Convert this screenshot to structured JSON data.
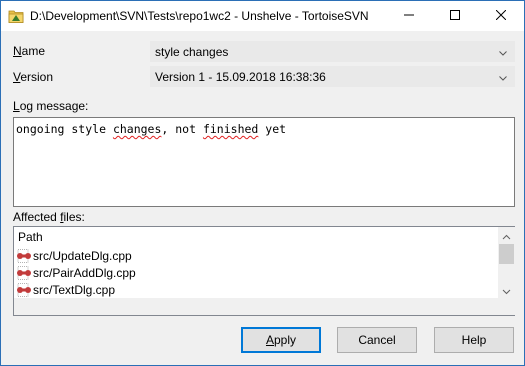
{
  "window": {
    "title": "D:\\Development\\SVN\\Tests\\repo1wc2 - Unshelve - TortoiseSVN",
    "minimize_icon": "minimize-icon",
    "maximize_icon": "maximize-icon",
    "close_icon": "close-icon"
  },
  "form": {
    "name_label_prefix": "",
    "name_label_accel": "N",
    "name_label_rest": "ame",
    "name_value": "style changes",
    "version_label_accel": "V",
    "version_label_rest": "ersion",
    "version_value": "Version 1 - 15.09.2018 16:38:36",
    "log_label_prefix": "",
    "log_label_accel": "L",
    "log_label_rest": "og message:",
    "log_text_1": "ongoing style ",
    "log_text_spell": "changes",
    "log_text_2": ", not ",
    "log_text_spell2": "finished",
    "log_text_3": " yet",
    "affected_label_prefix": "Affected ",
    "affected_label_accel": "f",
    "affected_label_rest": "iles:"
  },
  "files": {
    "header": "Path",
    "items": [
      {
        "path": "src/UpdateDlg.cpp"
      },
      {
        "path": "src/PairAddDlg.cpp"
      },
      {
        "path": "src/TextDlg.cpp"
      }
    ]
  },
  "buttons": {
    "apply_accel": "A",
    "apply_rest": "pply",
    "cancel": "Cancel",
    "help": "Help"
  },
  "colors": {
    "accent": "#0078d7",
    "title_border": "#2b6fb6",
    "spell_error": "#e02020"
  }
}
